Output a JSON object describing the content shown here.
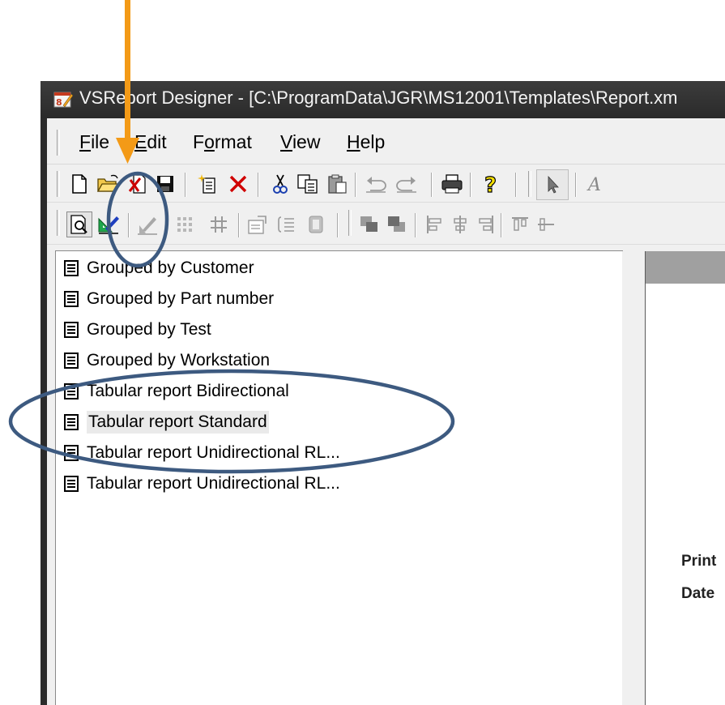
{
  "window": {
    "title": "VSReport Designer - [C:\\ProgramData\\JGR\\MS12001\\Templates\\Report.xm"
  },
  "menu": {
    "items": [
      {
        "label": "File",
        "accel": "F"
      },
      {
        "label": "Edit",
        "accel": "E"
      },
      {
        "label": "Format",
        "accel": "o"
      },
      {
        "label": "View",
        "accel": "V"
      },
      {
        "label": "Help",
        "accel": "H"
      }
    ]
  },
  "toolbar1": {
    "icons": [
      "new-icon",
      "open-folder-icon",
      "delete-report-icon",
      "save-icon",
      "new-field-icon",
      "delete-x-icon",
      "cut-icon",
      "copy-icon",
      "paste-icon",
      "undo-icon",
      "redo-icon",
      "print-icon",
      "help-icon",
      "pointer-icon",
      "label-icon"
    ]
  },
  "toolbar2": {
    "icons": [
      "preview-icon",
      "design-icon",
      "format-icon",
      "grid-icon",
      "snap-grid-icon",
      "properties-icon",
      "sorting-icon",
      "group-icon",
      "bring-front-icon",
      "send-back-icon",
      "align-left-icon",
      "align-center-icon",
      "align-right-icon",
      "align-top-icon",
      "align-middle-icon"
    ]
  },
  "reports": {
    "items": [
      {
        "label": "Grouped  by Customer"
      },
      {
        "label": "Grouped  by Part number"
      },
      {
        "label": "Grouped  by Test"
      },
      {
        "label": "Grouped  by Workstation"
      },
      {
        "label": "Tabular report Bidirectional"
      },
      {
        "label": "Tabular report Standard",
        "selected": true
      },
      {
        "label": "Tabular report Unidirectional RL..."
      },
      {
        "label": "Tabular report Unidirectional RL..."
      }
    ]
  },
  "preview": {
    "line1": "Print",
    "line2": "Date"
  },
  "colors": {
    "arrow": "#f39a17",
    "ellipse": "#3d5a80",
    "titlebar": "#2d2d2d"
  }
}
